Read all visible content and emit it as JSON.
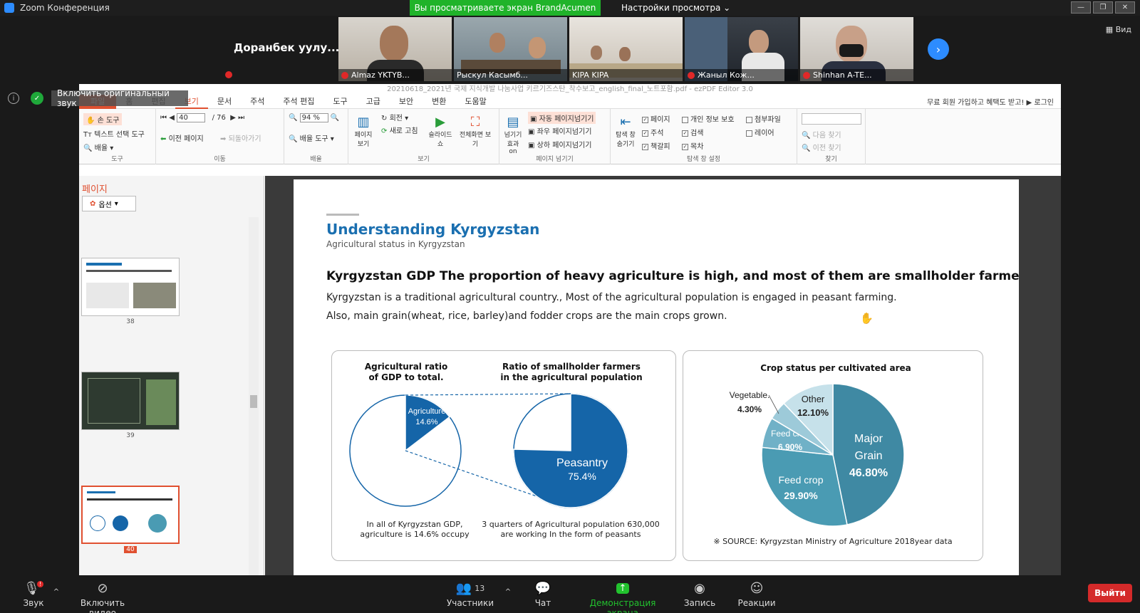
{
  "zoom": {
    "title": "Zoom Конференция",
    "banner": "Вы просматриваете экран BrandAcumen",
    "view_options": "Настройки просмотра",
    "view_label": "Вид",
    "orig_sound": "Включить оригинальный звук",
    "big_name": "Доранбек  уулу...",
    "participants": [
      "Almaz YKTYB...",
      "Рыскул Касымб...",
      "KIPA KIPA",
      "Жаныл Кож...",
      "Shinhan A-TE..."
    ],
    "toolbar": {
      "audio": "Звук",
      "video": "Включить видео",
      "participants": "Участники",
      "participants_count": "13",
      "chat": "Чат",
      "share": "Демонстрация экрана",
      "record": "Запись",
      "reactions": "Реакции",
      "exit": "Выйти"
    }
  },
  "ezpdf": {
    "title": "20210618_2021년 국제 지식개발 나눔사업 키르기즈스탄_착수보고_english_final_노트포함.pdf - ezPDF Editor 3.0",
    "menu": [
      "파일",
      "홈",
      "편집",
      "보기",
      "문서",
      "주석",
      "주석 편집",
      "도구",
      "고급",
      "보안",
      "변환",
      "도움말"
    ],
    "signup": "무료 회원 가입하고 혜택도 받고! ▶ 로그인",
    "ribbon": {
      "hand_tool": "손 도구",
      "text_select": "텍스트 선택 도구",
      "zoom_tool": "배율",
      "group_tools": "도구",
      "page_value": "40",
      "page_total": "/ 76",
      "prev_page": "이전 페이지",
      "back": "되돌아가기",
      "group_move": "이동",
      "zoom_value": "94 %",
      "zoom_tools": "배율 도구",
      "group_zoom": "배율",
      "page_view": "페이지 보기",
      "rotate": "회전",
      "refresh": "새로 고침",
      "slideshow": "슬라이드 쇼",
      "fullscreen": "전체화면 보기",
      "group_view": "보기",
      "flip_effect": "넘기기 효과 on",
      "auto_flip": "자동 페이지넘기기",
      "lr_flip": "좌우 페이지넘기기",
      "ud_flip": "상하 페이지넘기기",
      "group_flip": "페이지 넘기기",
      "nav_hide": "탐색 창 숨기기",
      "cb_page": "페이지",
      "cb_note": "주석",
      "cb_bookmark": "책갈피",
      "cb_privacy": "개인 정보 보호",
      "cb_search": "검색",
      "cb_toc": "목차",
      "cb_attach": "첨부파일",
      "cb_layer": "레이어",
      "group_nav": "탐색 창 설정",
      "find_next": "다음 찾기",
      "find_prev": "이전 찾기",
      "group_find": "찾기"
    },
    "sidebar": {
      "title": "페이지",
      "options": "옵션",
      "thumbs": [
        "38",
        "39",
        "40"
      ]
    }
  },
  "slide": {
    "title": "Understanding Kyrgyzstan",
    "subtitle": "Agricultural status in Kyrgyzstan",
    "headline": "Kyrgyzstan GDP The proportion of heavy agriculture is high, and most of them are smallholder farmers",
    "line1": "Kyrgyzstan is a traditional agricultural country., Most of the agricultural population is engaged in peasant farming.",
    "line2": "Also, main grain(wheat, rice, barley)and fodder crops are the main crops grown.",
    "c1_title_a": "Agricultural ratio",
    "c1_title_b": "of GDP to total.",
    "c1_cap_a": "In all of Kyrgyzstan GDP,",
    "c1_cap_b": "agriculture is 14.6% occupy",
    "c2_title_a": "Ratio of smallholder farmers",
    "c2_title_b": "in the agricultural population",
    "c2_cap_a": "3 quarters of  Agricultural population 630,000",
    "c2_cap_b": "are working In the form  of peasants",
    "c3_title": "Crop status per cultivated area",
    "source": "※ SOURCE: Kyrgyzstan Ministry of Agriculture 2018year data"
  },
  "chart_data": [
    {
      "type": "pie",
      "title": "Agricultural ratio of GDP to total.",
      "slices": [
        {
          "label": "Agriculture",
          "value": 14.6,
          "text": "14.6%"
        }
      ],
      "colors": [
        "#1565a8"
      ]
    },
    {
      "type": "pie",
      "title": "Ratio of smallholder farmers in the agricultural population",
      "slices": [
        {
          "label": "Peasantry",
          "value": 75.4,
          "text": "75.4%"
        }
      ],
      "colors": [
        "#1565a8"
      ]
    },
    {
      "type": "pie",
      "title": "Crop status per cultivated area",
      "slices": [
        {
          "label": "Major Grain",
          "value": 46.8,
          "text": "46.80%"
        },
        {
          "label": "Feed crop",
          "value": 29.9,
          "text": "29.90%"
        },
        {
          "label": "Feed crop",
          "value": 6.9,
          "text": "6.90%"
        },
        {
          "label": "Vegetable.",
          "value": 4.3,
          "text": "4.30%"
        },
        {
          "label": "Other",
          "value": 12.1,
          "text": "12.10%"
        }
      ],
      "colors": [
        "#3f89a3",
        "#4a9bb3",
        "#70b1c7",
        "#9dcad9",
        "#c6e1ea"
      ]
    }
  ]
}
